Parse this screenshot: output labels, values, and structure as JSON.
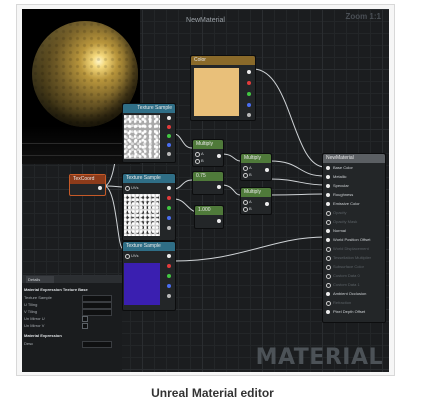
{
  "window": {
    "title": "NewMaterial",
    "zoom_label": "Zoom 1:1"
  },
  "preview": {
    "description_icon": "sphere-preview"
  },
  "nodes": {
    "color": {
      "title": "Color",
      "header_color": "#8a6a2a",
      "swatch_color": "#e9c07a"
    },
    "texture_sample_top": {
      "title": "Texture Sample",
      "header_color": "#2f6e86"
    },
    "texture_sample_mid": {
      "title": "Texture Sample",
      "header_color": "#2f6e86",
      "uv_label": "UVs"
    },
    "texture_sample_bottom": {
      "title": "Texture Sample",
      "header_color": "#2f6e86",
      "uv_label": "UVs",
      "swatch_color": "#3a1fb0"
    },
    "texcoord": {
      "title": "TexCoord",
      "header_color": "#8c3b1a"
    },
    "multiply_1": {
      "title": "Multiply",
      "header_color": "#4f7a3a",
      "a": "A",
      "b": "B"
    },
    "multiply_2": {
      "title": "Multiply",
      "header_color": "#4f7a3a",
      "a": "A",
      "b": "B"
    },
    "multiply_3": {
      "title": "Multiply",
      "header_color": "#4f7a3a",
      "a": "A",
      "b": "B"
    },
    "multiply_4": {
      "title": "Multiply",
      "header_color": "#4f7a3a",
      "a": "A",
      "b": "B"
    },
    "const_1": {
      "title": "0.75",
      "header_color": "#4f7a3a"
    },
    "const_2": {
      "title": "1.000",
      "header_color": "#4f7a3a"
    },
    "result": {
      "title": "NewMaterial",
      "header_color": "#5b5f63",
      "pins": [
        {
          "label": "Base Color",
          "active": true
        },
        {
          "label": "Metallic",
          "active": true
        },
        {
          "label": "Specular",
          "active": true
        },
        {
          "label": "Roughness",
          "active": true
        },
        {
          "label": "Emissive Color",
          "active": true
        },
        {
          "label": "Opacity",
          "active": false
        },
        {
          "label": "Opacity Mask",
          "active": false
        },
        {
          "label": "Normal",
          "active": true
        },
        {
          "label": "World Position Offset",
          "active": true
        },
        {
          "label": "World Displacement",
          "active": false
        },
        {
          "label": "Tessellation Multiplier",
          "active": false
        },
        {
          "label": "Subsurface Color",
          "active": false
        },
        {
          "label": "Custom Data 0",
          "active": false
        },
        {
          "label": "Custom Data 1",
          "active": false
        },
        {
          "label": "Ambient Occlusion",
          "active": true
        },
        {
          "label": "Refraction",
          "active": false
        },
        {
          "label": "Pixel Depth Offset",
          "active": true
        }
      ]
    }
  },
  "details": {
    "tab_label": "Details",
    "section_1": "Material Expression Texture Base",
    "rows": [
      {
        "label": "Texture Sample",
        "kind": "field"
      },
      {
        "label": "U Tiling",
        "kind": "field"
      },
      {
        "label": "V Tiling",
        "kind": "field"
      },
      {
        "label": "Un Mirror U",
        "kind": "check"
      },
      {
        "label": "Un Mirror V",
        "kind": "check"
      }
    ],
    "section_2": "Material Expression",
    "desc_label": "Desc"
  },
  "watermark": "MATERIAL",
  "caption": "Unreal Material editor"
}
